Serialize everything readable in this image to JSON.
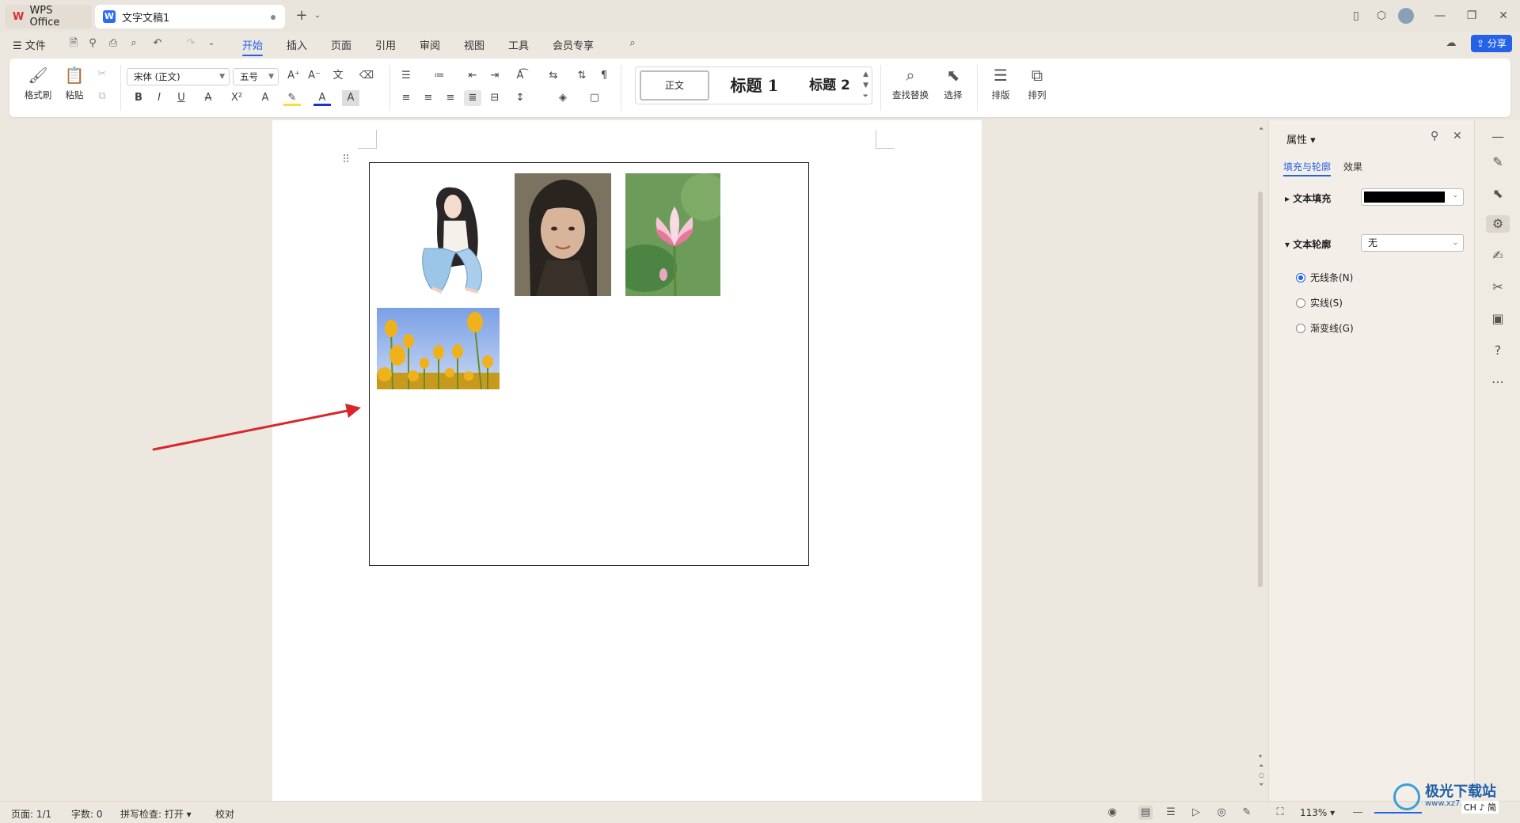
{
  "titlebar": {
    "app_tab_label": "WPS Office",
    "doc_tab_label": "文字文稿1"
  },
  "menubar": {
    "file_label": "文件",
    "tabs": [
      "开始",
      "插入",
      "页面",
      "引用",
      "审阅",
      "视图",
      "工具",
      "会员专享"
    ],
    "active_tab": "开始",
    "share_label": "分享"
  },
  "ribbon": {
    "format_painter": "格式刷",
    "paste": "粘贴",
    "font_name": "宋体 (正文)",
    "font_size": "五号",
    "styles": [
      "正文",
      "标题 1",
      "标题 2"
    ],
    "find_replace": "查找替换",
    "select": "选择",
    "layout": "排版",
    "arrange": "排列"
  },
  "panel": {
    "title": "属性",
    "tabs": [
      "填充与轮廓",
      "效果"
    ],
    "active_tab": "填充与轮廓",
    "text_fill_label": "文本填充",
    "text_fill_color": "#000000",
    "text_outline_label": "文本轮廓",
    "text_outline_value": "无",
    "outline_options": [
      "无线条(N)",
      "实线(S)",
      "渐变线(G)"
    ],
    "selected_outline": "无线条(N)"
  },
  "statusbar": {
    "page": "页面: 1/1",
    "words": "字数: 0",
    "spellcheck": "拼写检查: 打开",
    "proofread": "校对",
    "zoom": "113%"
  },
  "watermark": {
    "site": "极光下载站",
    "url": "www.xz7.com",
    "ime": "CH ♪ 简"
  },
  "colors": {
    "accent": "#2462e8",
    "arrow": "#d9262a",
    "wps_red": "#d9302c"
  }
}
